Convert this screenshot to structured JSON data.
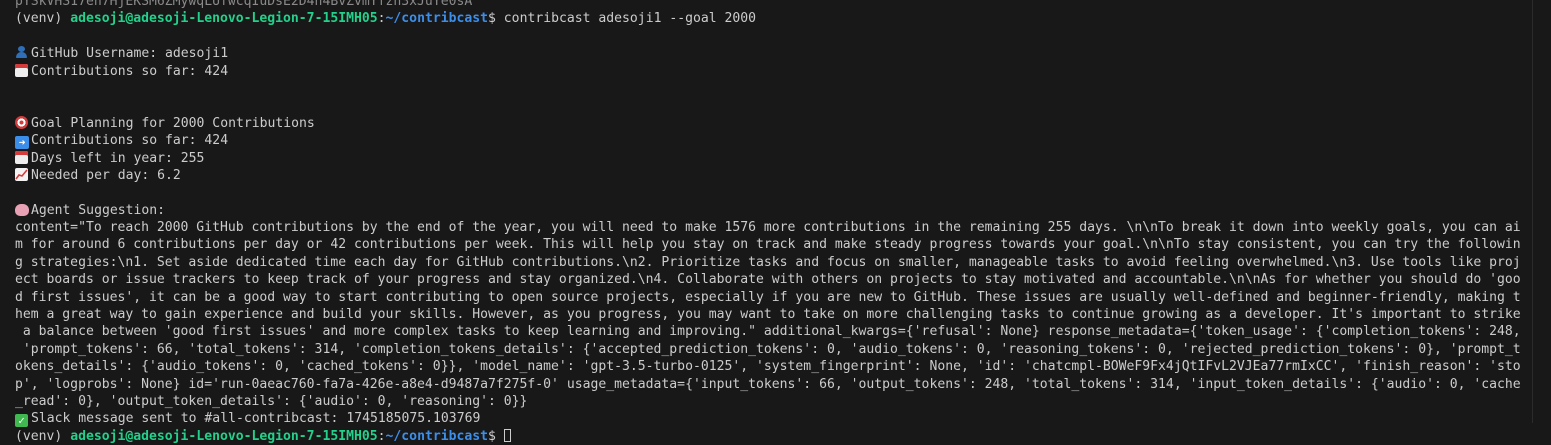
{
  "terminal": {
    "top_cut": "pYSkVHS17en7HjEKSM6ZMywqLUfwcqIuDsE2D4n4BvZvmYfzh3xJuYe0sA",
    "prompt": {
      "venv": "(venv) ",
      "user_host": "adesoji@adesoji-Lenovo-Legion-7-15IMH05",
      "sep": ":",
      "path": "~/contribcast",
      "symbol": "$ ",
      "command": "contribcast adesoji1 --goal 2000"
    },
    "username_line": "GitHub Username: adesoji1",
    "contrib_line": "Contributions so far: 424",
    "goal_title": "Goal Planning for 2000 Contributions",
    "goal_contrib": "Contributions so far: 424",
    "days_left": "Days left in year: 255",
    "needed_per_day": "Needed per day: 6.2",
    "agent_title": "Agent Suggestion:",
    "content_lines": [
      "content=\"To reach 2000 GitHub contributions by the end of the year, you will need to make 1576 more contributions in the remaining 255 days. \\n\\nTo break it down into weekly goals, you can ai",
      "m for around 6 contributions per day or 42 contributions per week. This will help you stay on track and make steady progress towards your goal.\\n\\nTo stay consistent, you can try the followin",
      "g strategies:\\n1. Set aside dedicated time each day for GitHub contributions.\\n2. Prioritize tasks and focus on smaller, manageable tasks to avoid feeling overwhelmed.\\n3. Use tools like proj",
      "ect boards or issue trackers to keep track of your progress and stay organized.\\n4. Collaborate with others on projects to stay motivated and accountable.\\n\\nAs for whether you should do 'goo",
      "d first issues', it can be a good way to start contributing to open source projects, especially if you are new to GitHub. These issues are usually well-defined and beginner-friendly, making t",
      "hem a great way to gain experience and build your skills. However, as you progress, you may want to take on more challenging tasks to continue growing as a developer. It's important to strike",
      " a balance between 'good first issues' and more complex tasks to keep learning and improving.\" additional_kwargs={'refusal': None} response_metadata={'token_usage': {'completion_tokens': 248,",
      " 'prompt_tokens': 66, 'total_tokens': 314, 'completion_tokens_details': {'accepted_prediction_tokens': 0, 'audio_tokens': 0, 'reasoning_tokens': 0, 'rejected_prediction_tokens': 0}, 'prompt_t",
      "okens_details': {'audio_tokens': 0, 'cached_tokens': 0}}, 'model_name': 'gpt-3.5-turbo-0125', 'system_fingerprint': None, 'id': 'chatcmpl-BOWeF9Fx4jQtIFvL2VJEa77rmIxCC', 'finish_reason': 'sto",
      "p', 'logprobs': None} id='run-0aeac760-fa7a-426e-a8e4-d9487a7f275f-0' usage_metadata={'input_tokens': 66, 'output_tokens': 248, 'total_tokens': 314, 'input_token_details': {'audio': 0, 'cache",
      "_read': 0}, 'output_token_details': {'audio': 0, 'reasoning': 0}}"
    ],
    "slack_line": "Slack message sent to #all-contribcast: 1745185075.103769",
    "final_prompt": {
      "venv": "(venv) ",
      "user_host": "adesoji@adesoji-Lenovo-Legion-7-15IMH05",
      "sep": ":",
      "path": "~/contribcast",
      "symbol": "$ "
    },
    "icons": {
      "user": "bust-in-silhouette-icon",
      "calendar": "calendar-icon",
      "target": "target-icon",
      "arrow": "right-arrow-icon",
      "chart": "chart-increasing-icon",
      "brain": "brain-icon",
      "check": "check-mark-icon"
    },
    "colors": {
      "background": "#181818",
      "text": "#cccccc",
      "user_host": "#23d18b",
      "path": "#3b8eea"
    }
  }
}
